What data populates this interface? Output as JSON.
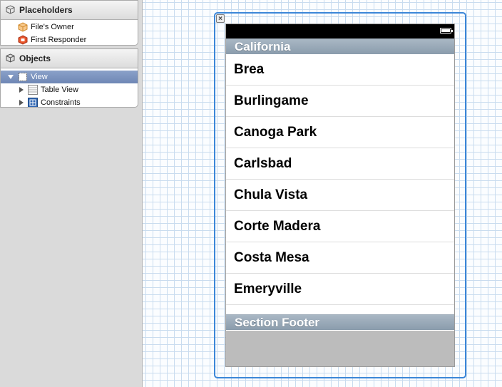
{
  "outline": {
    "placeholders": {
      "title": "Placeholders",
      "items": [
        {
          "label": "File's Owner",
          "icon": "files-owner-cube-icon"
        },
        {
          "label": "First Responder",
          "icon": "first-responder-icon"
        }
      ]
    },
    "objects": {
      "title": "Objects",
      "view": {
        "label": "View",
        "icon": "view-icon"
      },
      "children": [
        {
          "label": "Table View",
          "icon": "table-view-icon"
        },
        {
          "label": "Constraints",
          "icon": "constraints-icon"
        }
      ]
    }
  },
  "canvas": {
    "section_header": "California",
    "cells": [
      "Brea",
      "Burlingame",
      "Canoga Park",
      "Carlsbad",
      "Chula Vista",
      "Corte Madera",
      "Costa Mesa",
      "Emeryville"
    ],
    "section_footer": "Section Footer"
  },
  "colors": {
    "selection": "#3c87d8",
    "section_header": "#9aa9b8",
    "row_selected": "#7d93bf"
  }
}
